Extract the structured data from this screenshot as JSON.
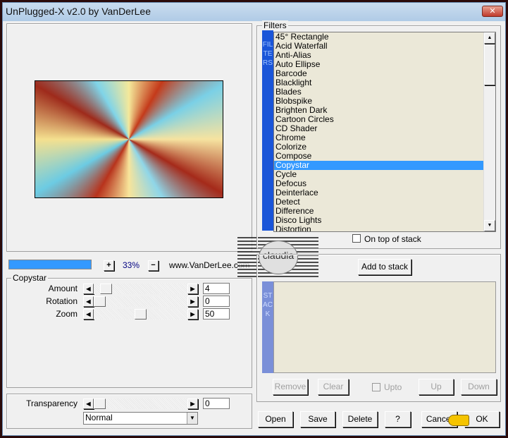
{
  "window": {
    "title": "UnPlugged-X v2.0 by VanDerLee",
    "close": "✕"
  },
  "zoom": {
    "plus": "+",
    "value": "33%",
    "minus": "−",
    "progress": 1.0,
    "site": "www.VanDerLee.com"
  },
  "params": {
    "group": "Copystar",
    "rows": [
      {
        "label": "Amount",
        "value": "4",
        "pos": 0.08
      },
      {
        "label": "Rotation",
        "value": "0",
        "pos": 0
      },
      {
        "label": "Zoom",
        "value": "50",
        "pos": 0.5
      }
    ]
  },
  "transparency": {
    "label": "Transparency",
    "value": "0",
    "pos": 0,
    "mode": "Normal"
  },
  "filters": {
    "group": "Filters",
    "bar": "FILTERS",
    "selected": "Copystar",
    "items": [
      "45° Rectangle",
      "Acid Waterfall",
      "Anti-Alias",
      "Auto Ellipse",
      "Barcode",
      "Blacklight",
      "Blades",
      "Blobspike",
      "Brighten Dark",
      "Cartoon Circles",
      "CD Shader",
      "Chrome",
      "Colorize",
      "Compose",
      "Copystar",
      "Cycle",
      "Defocus",
      "Deinterlace",
      "Detect",
      "Difference",
      "Disco Lights",
      "Distortion"
    ],
    "on_top": "On top of stack"
  },
  "stack": {
    "add": "Add to stack",
    "bar": "STACK",
    "remove": "Remove",
    "clear": "Clear",
    "upto": "Upto",
    "up": "Up",
    "down": "Down"
  },
  "buttons": {
    "open": "Open",
    "save": "Save",
    "delete": "Delete",
    "help": "?",
    "cancel": "Cancel",
    "ok": "OK"
  },
  "watermark": "claudia",
  "colors": {
    "accent": "#3399ff",
    "bar": "#1a55d8"
  }
}
